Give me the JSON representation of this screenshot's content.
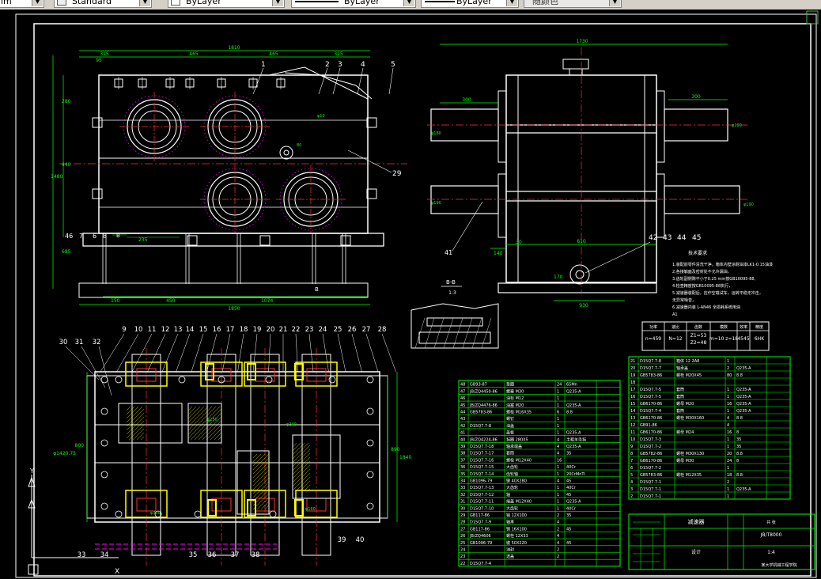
{
  "toolbar": {
    "partial_left": "im",
    "text_style": "Standard",
    "layer_color": "ByLayer",
    "linetype": "ByLayer",
    "lineweight": "ByLayer",
    "plot_style": "随颜色"
  },
  "drawing": {
    "top_view_labels": [
      "1",
      "2",
      "3",
      "4",
      "5",
      "29",
      "46",
      "7",
      "6",
      "8"
    ],
    "top_dims": {
      "overall_width": "1810",
      "left_end": "315",
      "mid1": "465",
      "mid2": "465",
      "right_end": "315",
      "left_mid": "95",
      "h1": "280",
      "h2": "440",
      "h3": "1480",
      "h4": "685",
      "h5": "205",
      "h6": "850",
      "h7": "1850",
      "left_foot": "150",
      "anchor": "235",
      "b_label": "B"
    },
    "side_view_dims": {
      "width": "1730",
      "left_shaft": "300",
      "right_shaft": "300",
      "d1": "φ180",
      "d2": "φ190",
      "d3": "φ190",
      "d4": "φ190",
      "base": "930",
      "b1": "610",
      "b2": "140",
      "b3": "30",
      "b4": "170"
    },
    "side_callouts": [
      "42",
      "43",
      "44",
      "45",
      "41"
    ],
    "section_title": "B-B",
    "section_scale": "1:3",
    "tech_req_title": "技术要求",
    "tech_req_lines": [
      "1.装配前零件清洗干净，箱体内壁涂耐油漆LK1-0.15油漆",
      "2.各接触面及密封处不允许漏油，",
      "3.齿轮副侧隙不小于0.25 mm按GB10095-88,",
      "4.检查精度按GB10095-88执行，",
      "5.减速器装配后，应作空载试车，运转平稳无冲击，",
      "  无异常噪音，",
      "6.减速器内装 L-AN46 全损耗系统用油",
      "  A1"
    ],
    "spec_table": {
      "headers": [
        "功率",
        "速比",
        "齿数",
        "模数",
        "效率",
        "精度"
      ],
      "values": [
        "n=459",
        "N=12",
        "Z1=53\nZ2=48",
        "m=10 z=18",
        "4545",
        "6HK"
      ]
    },
    "plan_labels_top": [
      "9",
      "10",
      "11",
      "12",
      "13",
      "14",
      "15",
      "16",
      "17",
      "18",
      "19",
      "20",
      "21",
      "22",
      "23",
      "24",
      "25",
      "26",
      "27",
      "28"
    ],
    "plan_labels_left": [
      "30",
      "31",
      "32"
    ],
    "plan_labels_bottom": [
      "33",
      "34",
      "35",
      "36",
      "37",
      "38",
      "39",
      "40"
    ],
    "plan_dims": {
      "left": "800",
      "h1": "φ1420.75",
      "right1": "890",
      "right2": "1840",
      "r1": "φ250",
      "r2": "φ240",
      "r3": "φ300",
      "r4": "φ160"
    },
    "bom": [
      [
        "48",
        "GB93-87",
        "垫圈",
        "24",
        "65Mn",
        ""
      ],
      [
        "47",
        "JB/ZQ4450-86",
        "螺塞 M30",
        "1",
        "Q235-A",
        ""
      ],
      [
        "46",
        "",
        "油标 M12",
        "1",
        "",
        ""
      ],
      [
        "45",
        "JB/ZQ4476-86",
        "油塞 M20",
        "1",
        "Q235-A",
        ""
      ],
      [
        "44",
        "GB5783-86",
        "螺栓 M16X35",
        "6",
        "8.8",
        ""
      ],
      [
        "43",
        "",
        "螺钉",
        "1",
        "",
        ""
      ],
      [
        "42",
        "D15Q7.7-8",
        "油盖",
        "1",
        "",
        ""
      ],
      [
        "41",
        "",
        "盖板",
        "1",
        "Q235-A",
        ""
      ],
      [
        "40",
        "JB/ZQ4224-86",
        "毡圈 280X5",
        "4",
        "半粗羊毛毡",
        ""
      ],
      [
        "39",
        "D15Q7.7-18",
        "轴承端盖",
        "4",
        "Q235-A",
        ""
      ],
      [
        "38",
        "D15Q7.7-17",
        "套筒",
        "4",
        "35",
        ""
      ],
      [
        "37",
        "D15Q7.7-16",
        "螺栓 M12X40",
        "16",
        "",
        ""
      ],
      [
        "36",
        "D15Q7.7-15",
        "大齿轮",
        "1",
        "40Cr",
        ""
      ],
      [
        "35",
        "D15Q7.7-14",
        "齿轮轴",
        "1",
        "20CrMnTi",
        ""
      ],
      [
        "34",
        "GB1096-79",
        "键 40X280",
        "4",
        "45",
        ""
      ],
      [
        "33",
        "D15Q7.7-13",
        "大齿轮",
        "1",
        "40Cr",
        ""
      ],
      [
        "32",
        "D15Q7.7-12",
        "轴",
        "1",
        "45",
        ""
      ],
      [
        "31",
        "D15Q7.7-11",
        "端盖 M12X40",
        "1",
        "Q235-A",
        ""
      ],
      [
        "30",
        "D15Q7.7-10",
        "大齿轮",
        "1",
        "40Cr",
        ""
      ],
      [
        "29",
        "GB117-86",
        "销 12X100",
        "2",
        "35",
        ""
      ],
      [
        "28",
        "D15Q7.7-9",
        "轴承",
        "4",
        "",
        ""
      ],
      [
        "27",
        "GB117-86",
        "销 16X100",
        "2",
        "45",
        ""
      ],
      [
        "26",
        "JB/ZQ4606",
        "螺栓 12X33",
        "4",
        "",
        ""
      ],
      [
        "25",
        "GB1096-79",
        "键 50X220",
        "4",
        "45",
        ""
      ],
      [
        "24",
        "",
        "油封",
        "2",
        "",
        ""
      ],
      [
        "23",
        "",
        "透盖",
        "2",
        "",
        ""
      ],
      [
        "22",
        "D15Q7.7-4",
        "",
        "",
        "",
        ""
      ]
    ],
    "bom_right": [
      [
        "21",
        "D15Q7.7-8",
        "箱体 12 2A8",
        "1",
        "",
        ""
      ],
      [
        "20",
        "D15Q7.7-7",
        "轴承盖",
        "2",
        "Q235-A",
        ""
      ],
      [
        "19",
        "GB5783-86",
        "螺栓 M20X45",
        "80",
        "8.8",
        ""
      ],
      [
        "18",
        "",
        "",
        "",
        "",
        ""
      ],
      [
        "17",
        "D15Q7.7-5",
        "套筒",
        "1",
        "Q235-A",
        ""
      ],
      [
        "16",
        "D15Q7.7-5",
        "套筒",
        "1",
        "Q235-A",
        ""
      ],
      [
        "15",
        "GB6170-86",
        "螺母 M20",
        "16",
        "Q235-A",
        ""
      ],
      [
        "14",
        "D15Q7.7-4",
        "套筒",
        "1",
        "Q235-A",
        ""
      ],
      [
        "13",
        "GB6170-86",
        "螺栓 M30X160",
        "4",
        "8.8",
        ""
      ],
      [
        "12",
        "GB91-86",
        "",
        "4",
        "",
        ""
      ],
      [
        "11",
        "GB6170-86",
        "螺母 M24",
        "16",
        "8",
        ""
      ],
      [
        "10",
        "D15Q7.7-3",
        "",
        "1",
        "35",
        ""
      ],
      [
        "9",
        "D15Q7.7-2",
        "",
        "1",
        "35",
        ""
      ],
      [
        "8",
        "GB5782-86",
        "螺栓 M30X130",
        "20",
        "8.8",
        ""
      ],
      [
        "7",
        "GB6170-86",
        "螺母 M30",
        "24",
        "8",
        ""
      ],
      [
        "6",
        "D15Q7.7-2",
        "",
        "1",
        "",
        ""
      ],
      [
        "5",
        "GB5783-86",
        "螺栓 M12X35",
        "18",
        "8.8",
        ""
      ],
      [
        "4",
        "D15Q7.7-1",
        "",
        "2",
        "",
        ""
      ],
      [
        "3",
        "D15Q7.7-1",
        "",
        "1",
        "Q235-A",
        ""
      ],
      [
        "2",
        "D15Q7.7-1",
        "",
        "1",
        "",
        ""
      ]
    ],
    "title_block": {
      "name": "减速器",
      "drawing_no": "JB/T8000",
      "sheet": "共 张",
      "scale": "1:4",
      "designer": "设计",
      "school": "某大学机械工程学院"
    }
  }
}
